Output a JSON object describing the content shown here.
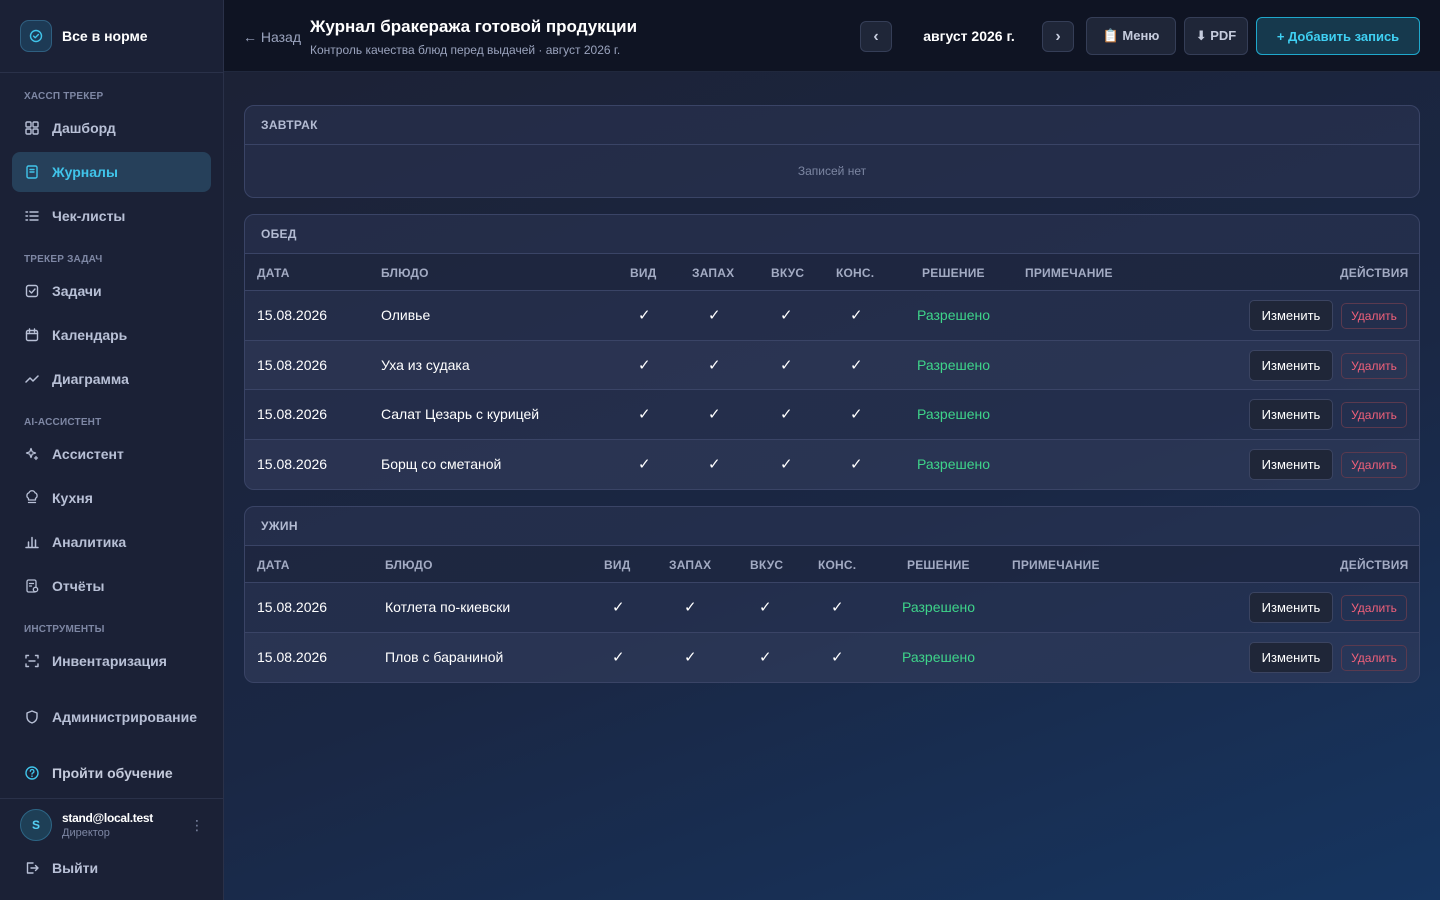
{
  "brand": {
    "title": "Все в норме"
  },
  "sidebar": {
    "sections": [
      {
        "title": "ХАССП ТРЕКЕР"
      },
      {
        "title": "ТРЕКЕР ЗАДАЧ"
      },
      {
        "title": "AI-АССИСТЕНТ"
      },
      {
        "title": "ИНСТРУМЕНТЫ"
      }
    ],
    "items": [
      {
        "label": "Дашборд",
        "icon": "grid-icon"
      },
      {
        "label": "Журналы",
        "icon": "journal-icon",
        "active": true
      },
      {
        "label": "Чек-листы",
        "icon": "checklist-icon"
      },
      {
        "label": "Задачи",
        "icon": "task-icon"
      },
      {
        "label": "Календарь",
        "icon": "calendar-icon"
      },
      {
        "label": "Диаграмма",
        "icon": "line-chart-icon"
      },
      {
        "label": "Ассистент",
        "icon": "sparkle-icon"
      },
      {
        "label": "Кухня",
        "icon": "chef-hat-icon"
      },
      {
        "label": "Аналитика",
        "icon": "bar-chart-icon"
      },
      {
        "label": "Отчёты",
        "icon": "report-icon"
      },
      {
        "label": "Инвентаризация",
        "icon": "scan-icon"
      },
      {
        "label": "Администрирование",
        "icon": "shield-icon"
      },
      {
        "label": "Пройти обучение",
        "icon": "help-icon"
      },
      {
        "label": "Выйти",
        "icon": "logout-icon"
      }
    ],
    "user": {
      "initial": "S",
      "email": "stand@local.test",
      "role": "Директор",
      "menu": "⋮"
    }
  },
  "header": {
    "back": "← Назад",
    "title": "Журнал бракеража готовой продукции",
    "subtitle": "Контроль качества блюд перед выдачей · август 2026 г.",
    "prev": "‹",
    "next": "›",
    "month": "август 2026 г.",
    "menu": "📋 Меню",
    "pdf": "⬇ PDF",
    "add": "+ Добавить запись"
  },
  "table_headers": {
    "date": "ДАТА",
    "dish": "БЛЮДО",
    "look": "ВИД",
    "smell": "ЗАПАХ",
    "taste": "ВКУС",
    "texture": "КОНС.",
    "decision": "РЕШЕНИЕ",
    "note": "ПРИМЕЧАНИЕ",
    "actions": "ДЕЙСТВИЯ"
  },
  "actions": {
    "edit": "Изменить",
    "delete": "Удалить"
  },
  "meals": {
    "breakfast": {
      "title": "ЗАВТРАК",
      "empty": "Записей нет"
    },
    "lunch": {
      "title": "ОБЕД",
      "rows": [
        {
          "date": "15.08.2026",
          "dish": "Оливье",
          "look": "✓",
          "smell": "✓",
          "taste": "✓",
          "texture": "✓",
          "decision": "Разрешено",
          "note": ""
        },
        {
          "date": "15.08.2026",
          "dish": "Уха из судака",
          "look": "✓",
          "smell": "✓",
          "taste": "✓",
          "texture": "✓",
          "decision": "Разрешено",
          "note": ""
        },
        {
          "date": "15.08.2026",
          "dish": "Салат Цезарь с курицей",
          "look": "✓",
          "smell": "✓",
          "taste": "✓",
          "texture": "✓",
          "decision": "Разрешено",
          "note": ""
        },
        {
          "date": "15.08.2026",
          "dish": "Борщ со сметаной",
          "look": "✓",
          "smell": "✓",
          "taste": "✓",
          "texture": "✓",
          "decision": "Разрешено",
          "note": ""
        }
      ]
    },
    "dinner": {
      "title": "УЖИН",
      "rows": [
        {
          "date": "15.08.2026",
          "dish": "Котлета по-киевски",
          "look": "✓",
          "smell": "✓",
          "taste": "✓",
          "texture": "✓",
          "decision": "Разрешено",
          "note": ""
        },
        {
          "date": "15.08.2026",
          "dish": "Плов с бараниной",
          "look": "✓",
          "smell": "✓",
          "taste": "✓",
          "texture": "✓",
          "decision": "Разрешено",
          "note": ""
        }
      ]
    }
  },
  "colors": {
    "accent": "#40c4ea",
    "success": "#3ed48a",
    "danger": "#f0607a"
  }
}
